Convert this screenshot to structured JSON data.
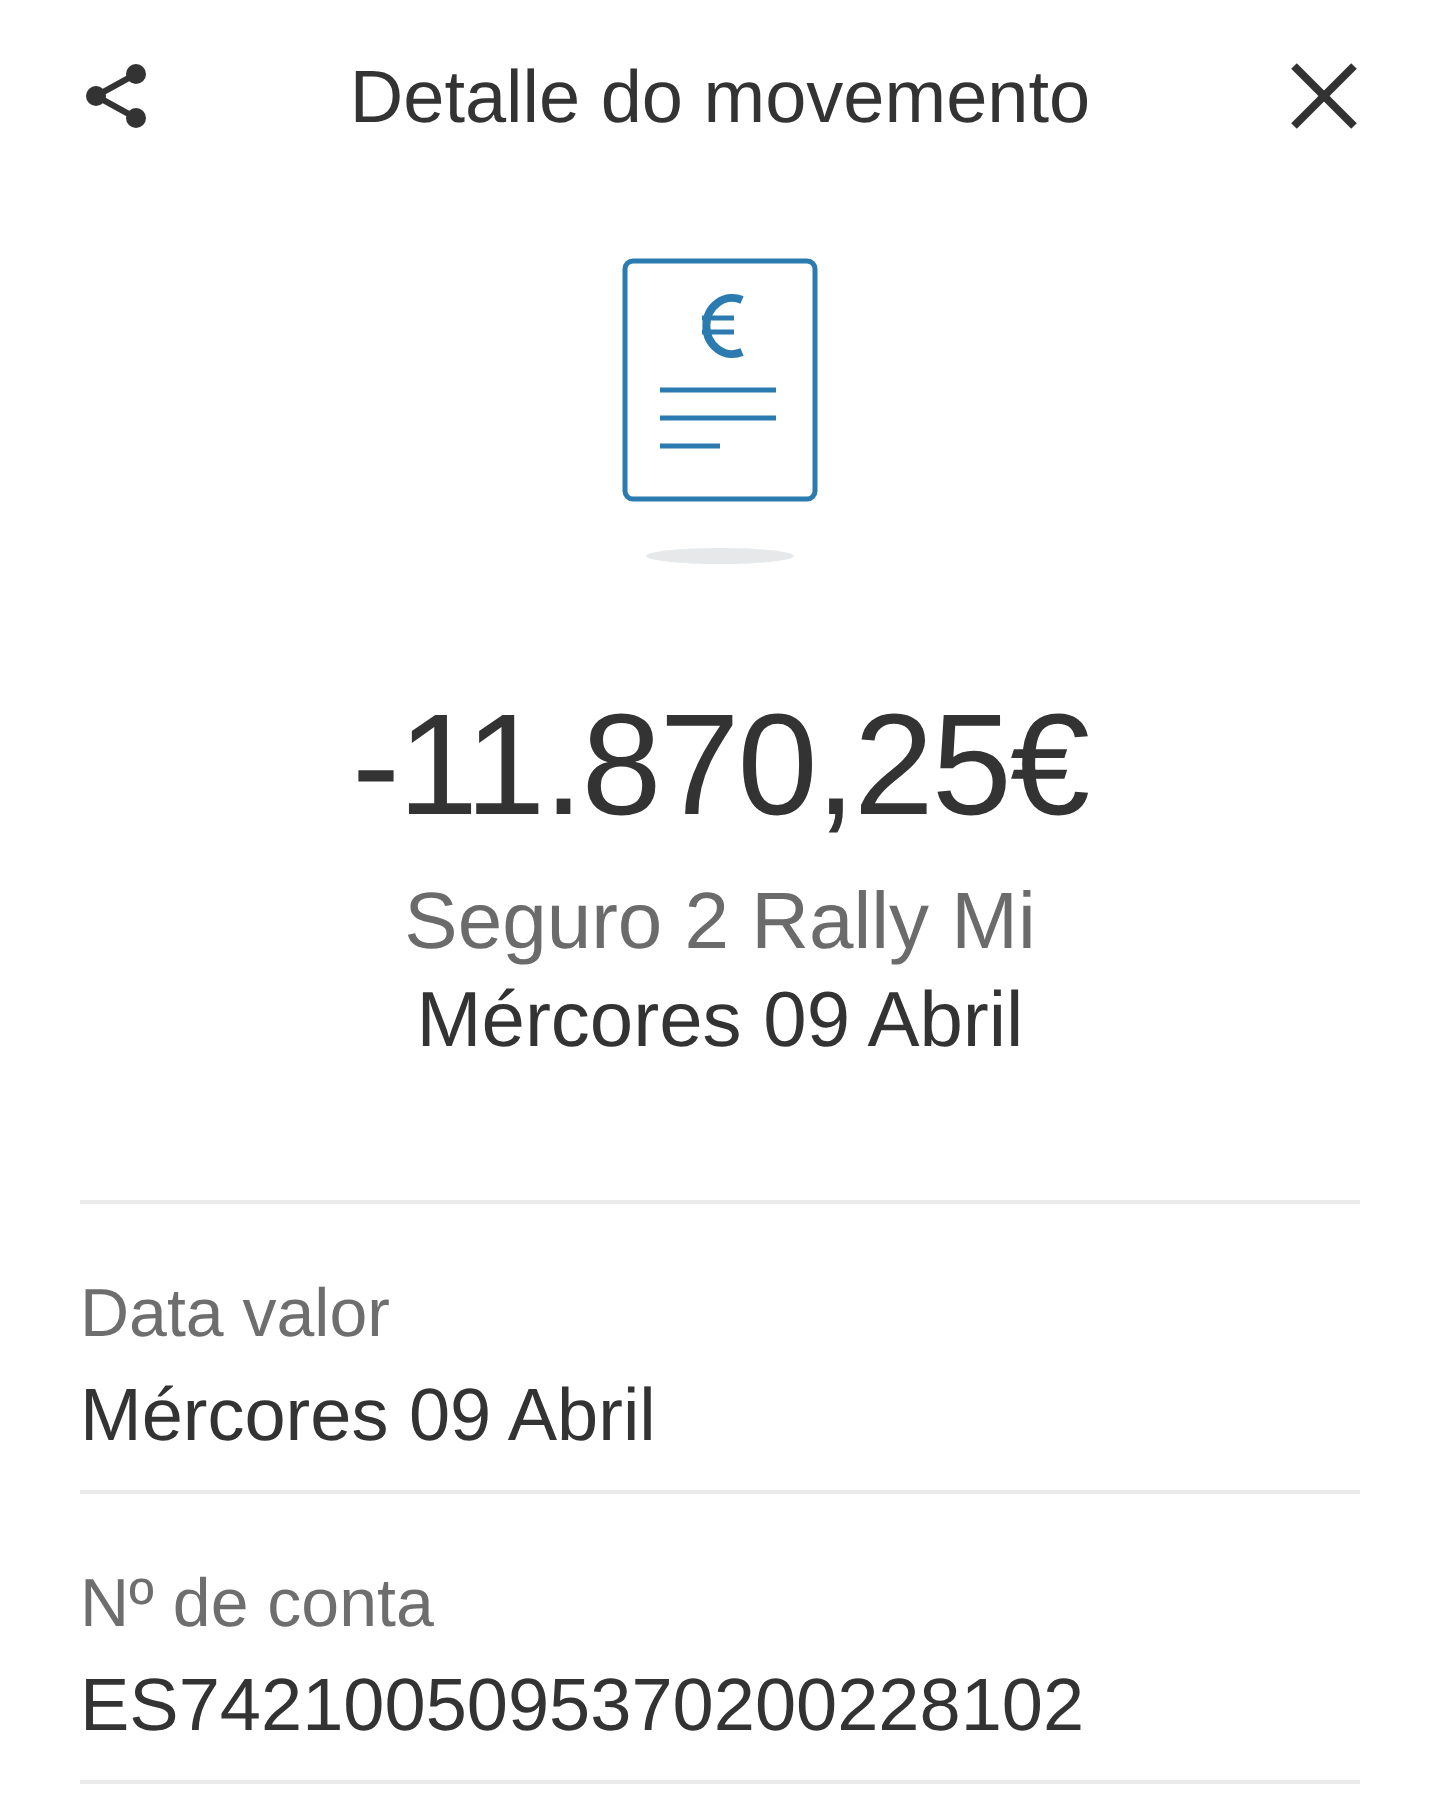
{
  "header": {
    "title": "Detalle do movemento"
  },
  "transaction": {
    "amount": "-11.870,25€",
    "concept": "Seguro 2 Rally Mi",
    "date": "Mércores 09 Abril"
  },
  "details": [
    {
      "label": "Data valor",
      "value": "Mércores 09 Abril"
    },
    {
      "label": "Nº de conta",
      "value": "ES7421005095370200228102"
    }
  ]
}
